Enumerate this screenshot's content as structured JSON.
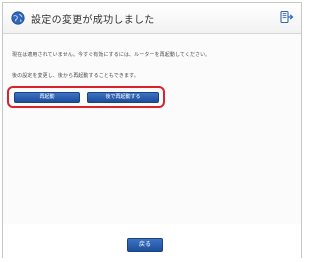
{
  "header": {
    "title": "設定の変更が成功しました",
    "icon": "globe-icon",
    "corner_icon": "export-icon"
  },
  "message": {
    "line1": "現在は適用されていません。今すぐ有効にするには、ルーターを再起動してください。",
    "line2": "後の設定を変更し、後から再起動することもできます。"
  },
  "buttons": {
    "restart": "再起動",
    "restart_later": "後で再起動する",
    "back": "戻る"
  },
  "colors": {
    "button_blue": "#2a5fb0",
    "highlight_red": "#d9222c"
  }
}
